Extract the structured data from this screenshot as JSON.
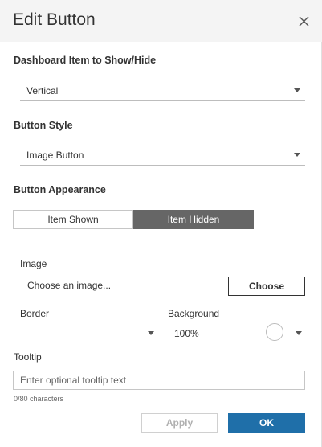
{
  "dialog": {
    "title": "Edit Button"
  },
  "dashboard_item": {
    "label": "Dashboard Item to Show/Hide",
    "value": "Vertical"
  },
  "button_style": {
    "label": "Button Style",
    "value": "Image Button"
  },
  "appearance": {
    "label": "Button Appearance",
    "tabs": [
      {
        "label": "Item Shown",
        "selected": false
      },
      {
        "label": "Item Hidden",
        "selected": true
      }
    ]
  },
  "image": {
    "label": "Image",
    "choose_text": "Choose an image...",
    "choose_button": "Choose"
  },
  "border": {
    "label": "Border",
    "value": ""
  },
  "background": {
    "label": "Background",
    "value": "100%",
    "swatch_color": "#ffffff"
  },
  "tooltip": {
    "label": "Tooltip",
    "placeholder": "Enter optional tooltip text",
    "value": "",
    "char_count": "0/80 characters"
  },
  "footer": {
    "apply_label": "Apply",
    "ok_label": "OK"
  },
  "colors": {
    "header_bg": "#f4f4f4",
    "selected_toggle": "#666666",
    "ok_button": "#1f6fa9"
  }
}
